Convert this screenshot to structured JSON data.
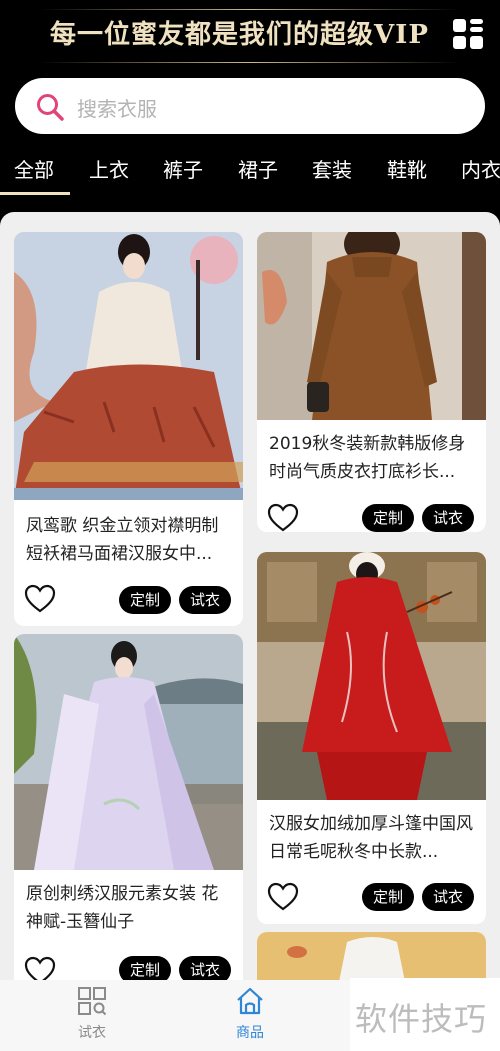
{
  "header": {
    "banner_title": "每一位蜜友都是我们的超级VIP",
    "menu_icon": "grid-menu-icon"
  },
  "search": {
    "placeholder": "搜索衣服",
    "icon": "search-icon",
    "accent": "#e0447a"
  },
  "tabs": [
    {
      "label": "全部",
      "active": true
    },
    {
      "label": "上衣"
    },
    {
      "label": "裤子"
    },
    {
      "label": "裙子"
    },
    {
      "label": "套装"
    },
    {
      "label": "鞋靴"
    },
    {
      "label": "内衣"
    }
  ],
  "products": [
    {
      "title": "凤鸾歌 织金立领对襟明制短袄裙马面裙汉服女中...",
      "customize": "定制",
      "try_on": "试衣"
    },
    {
      "title": "2019秋冬装新款韩版修身时尚气质皮衣打底衫长...",
      "customize": "定制",
      "try_on": "试衣"
    },
    {
      "title": "原创刺绣汉服元素女装 花神赋-玉簪仙子",
      "customize": "定制",
      "try_on": "试衣"
    },
    {
      "title": "汉服女加绒加厚斗篷中国风日常毛呢秋冬中长款...",
      "customize": "定制",
      "try_on": "试衣"
    }
  ],
  "bottom_nav": [
    {
      "label": "试衣",
      "icon": "fitting-grid-icon",
      "active": false
    },
    {
      "label": "商品",
      "icon": "home-icon",
      "active": true
    }
  ],
  "watermark": "软件技巧",
  "colors": {
    "header_bg": "#000000",
    "gold": "#f0e2c0",
    "active_nav": "#2f86d6"
  }
}
